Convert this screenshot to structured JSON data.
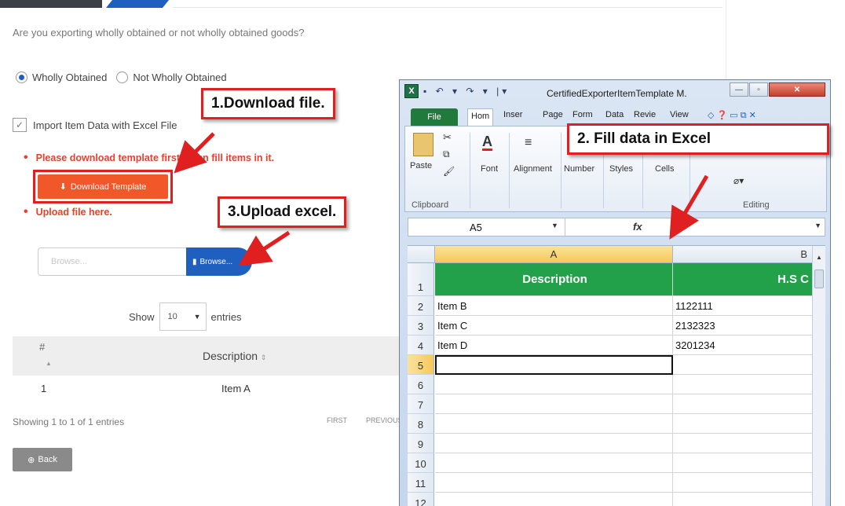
{
  "form": {
    "question": "Are you exporting wholly obtained or not wholly obtained goods?",
    "radio_wholly": "Wholly Obtained",
    "radio_not_wholly": "Not Wholly Obtained",
    "import_label": "Import Item Data with Excel File",
    "instruction_download": "Please download template first. Then fill items in it.",
    "download_button": "Download Template",
    "instruction_upload": "Upload file here.",
    "browse_placeholder": "Browse...",
    "browse_button": "Browse...",
    "show_label": "Show",
    "entries_value": "10",
    "entries_label": "entries",
    "table_headers": {
      "number": "#",
      "description": "Description"
    },
    "rows": [
      {
        "number": "1",
        "description": "Item A"
      }
    ],
    "showing_text": "Showing 1 to 1 of 1 entries",
    "pager_first": "FIRST",
    "pager_previous": "PREVIOUS",
    "back_button": "Back"
  },
  "callouts": {
    "step1": "1.Download file.",
    "step2": "2. Fill data in Excel",
    "step3": "3.Upload excel."
  },
  "excel": {
    "title": "CertifiedExporterItemTemplate M.",
    "tabs": [
      "File",
      "Hom",
      "Inser",
      "Page",
      "Form",
      "Data",
      "Revie",
      "View"
    ],
    "ribbon": {
      "paste": "Paste",
      "font": "Font",
      "alignment": "Alignment",
      "number": "Number",
      "styles": "Styles",
      "cells": "Cells",
      "clipboard": "Clipboard",
      "editing": "Editing"
    },
    "name_box": "A5",
    "fx": "fx",
    "columns": [
      "A",
      "B"
    ],
    "header_row": [
      "Description",
      "H.S C"
    ],
    "rows": [
      {
        "num": "2",
        "a": "Item B",
        "b": "1122111"
      },
      {
        "num": "3",
        "a": "Item C",
        "b": "2132323"
      },
      {
        "num": "4",
        "a": "Item D",
        "b": "3201234"
      }
    ],
    "row_numbers": [
      "1",
      "2",
      "3",
      "4",
      "5",
      "6",
      "7",
      "8",
      "9",
      "10",
      "11",
      "12"
    ]
  },
  "colors": {
    "accent_blue": "#1f5fbf",
    "alert_red": "#e8412b",
    "download_orange": "#f0582a",
    "excel_green": "#22a14a"
  }
}
